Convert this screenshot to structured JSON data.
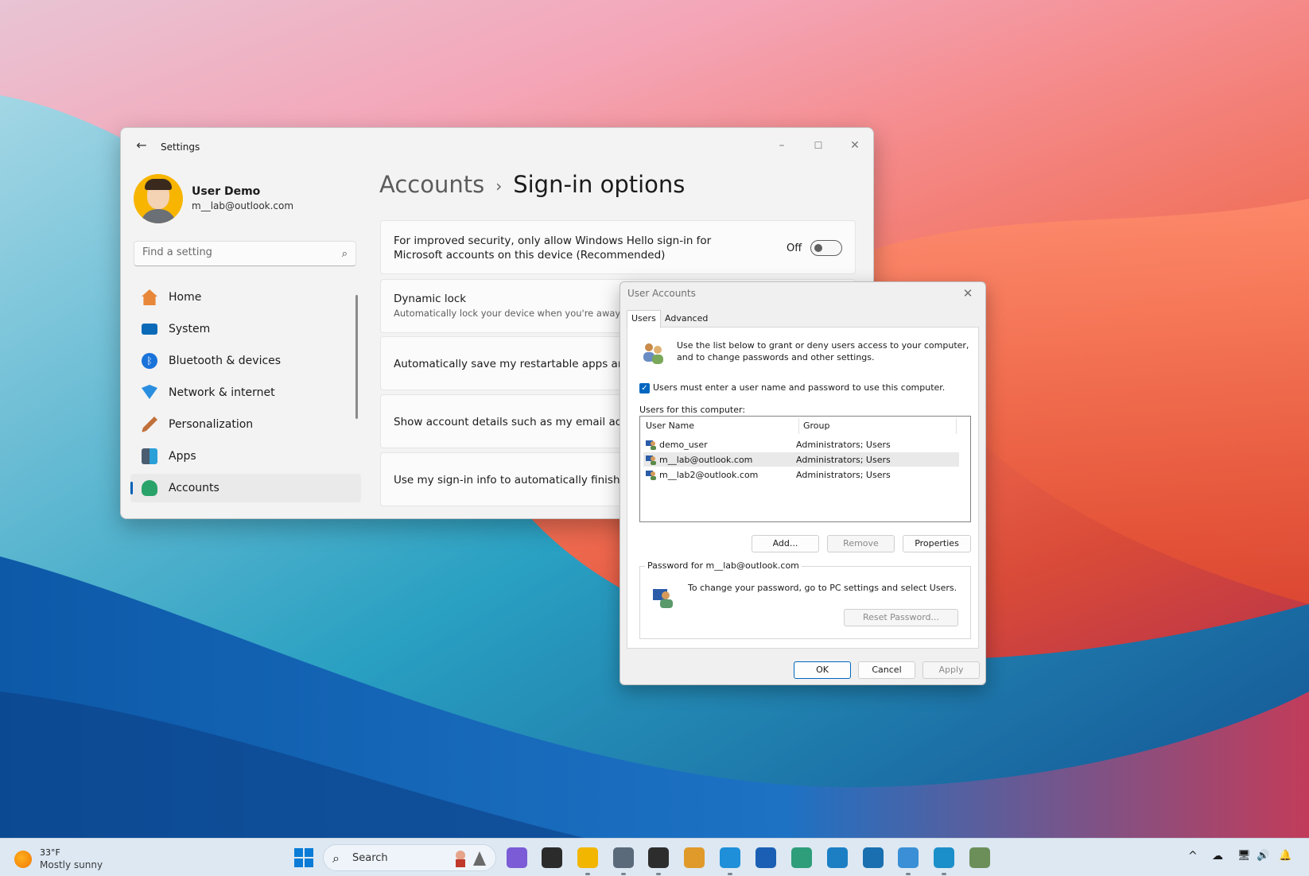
{
  "settings": {
    "window_title": "Settings",
    "window_controls": {
      "minimize": "–",
      "maximize": "☐",
      "close": "✕"
    },
    "user": {
      "name": "User Demo",
      "email": "m__lab@outlook.com"
    },
    "search_placeholder": "Find a setting",
    "nav": [
      {
        "label": "Home",
        "icon": "home-icon",
        "color": "#e8873a"
      },
      {
        "label": "System",
        "icon": "system-icon",
        "color": "#0a6ab8"
      },
      {
        "label": "Bluetooth & devices",
        "icon": "bluetooth-icon",
        "color": "#1a73d9"
      },
      {
        "label": "Network & internet",
        "icon": "wifi-icon",
        "color": "#2a8ee0"
      },
      {
        "label": "Personalization",
        "icon": "brush-icon",
        "color": "#c0703a"
      },
      {
        "label": "Apps",
        "icon": "apps-icon",
        "color": "#4b5d70"
      },
      {
        "label": "Accounts",
        "icon": "accounts-icon",
        "color": "#2aa36a",
        "active": true
      }
    ],
    "breadcrumb": {
      "parent": "Accounts",
      "separator": "›",
      "current": "Sign-in options"
    },
    "cards": [
      {
        "title": "For improved security, only allow Windows Hello sign-in for Microsoft accounts on this device (Recommended)",
        "toggle": "Off"
      },
      {
        "title": "Dynamic lock",
        "desc": "Automatically lock your device when you're away"
      },
      {
        "title": "Automatically save my restartable apps and re"
      },
      {
        "title": "Show account details such as my email addres"
      },
      {
        "title": "Use my sign-in info to automatically finish sett"
      }
    ]
  },
  "dialog": {
    "title": "User Accounts",
    "close": "✕",
    "tabs": [
      {
        "label": "Users",
        "active": true
      },
      {
        "label": "Advanced"
      }
    ],
    "info_text": "Use the list below to grant or deny users access to your computer, and to change passwords and other settings.",
    "checkbox": {
      "checked": true,
      "label": "Users must enter a user name and password to use this computer."
    },
    "users_label": "Users for this computer:",
    "columns": [
      "User Name",
      "Group"
    ],
    "users": [
      {
        "name": "demo_user",
        "group": "Administrators; Users"
      },
      {
        "name": "m__lab@outlook.com",
        "group": "Administrators; Users",
        "selected": true
      },
      {
        "name": "m__lab2@outlook.com",
        "group": "Administrators; Users"
      }
    ],
    "buttons": {
      "add": "Add...",
      "remove": "Remove",
      "properties": "Properties"
    },
    "password_group": {
      "legend": "Password for m__lab@outlook.com",
      "text": "To change your password, go to PC settings and select Users.",
      "reset": "Reset Password..."
    },
    "footer": {
      "ok": "OK",
      "cancel": "Cancel",
      "apply": "Apply"
    }
  },
  "taskbar": {
    "weather": {
      "temp": "33°F",
      "desc": "Mostly sunny"
    },
    "search_label": "Search",
    "apps": [
      {
        "name": "copilot-icon",
        "color": "#7b5cd6"
      },
      {
        "name": "task-view-icon",
        "color": "#2b2b2b"
      },
      {
        "name": "file-explorer-icon",
        "color": "#f2b600"
      },
      {
        "name": "settings-app-icon",
        "color": "#5a6a7a"
      },
      {
        "name": "terminal-icon",
        "color": "#2d2d2d"
      },
      {
        "name": "notes-app-icon",
        "color": "#e09a2a"
      },
      {
        "name": "edge-icon",
        "color": "#1e8fd8"
      },
      {
        "name": "store-icon",
        "color": "#1a5fb4"
      },
      {
        "name": "edge-canary-icon",
        "color": "#2e9e7a"
      },
      {
        "name": "edge-beta-icon",
        "color": "#1c7fc4"
      },
      {
        "name": "edge-dev-icon",
        "color": "#1a6fb0"
      },
      {
        "name": "notepad-icon",
        "color": "#3a8fd6"
      },
      {
        "name": "edge-icon-2",
        "color": "#1b8fc9"
      },
      {
        "name": "user-accounts-icon",
        "color": "#6c8f5a"
      }
    ],
    "tray": {
      "chevron": "^",
      "cloud": "☁",
      "network": "🖥",
      "volume": "🔊",
      "notifications": "🔔"
    }
  }
}
